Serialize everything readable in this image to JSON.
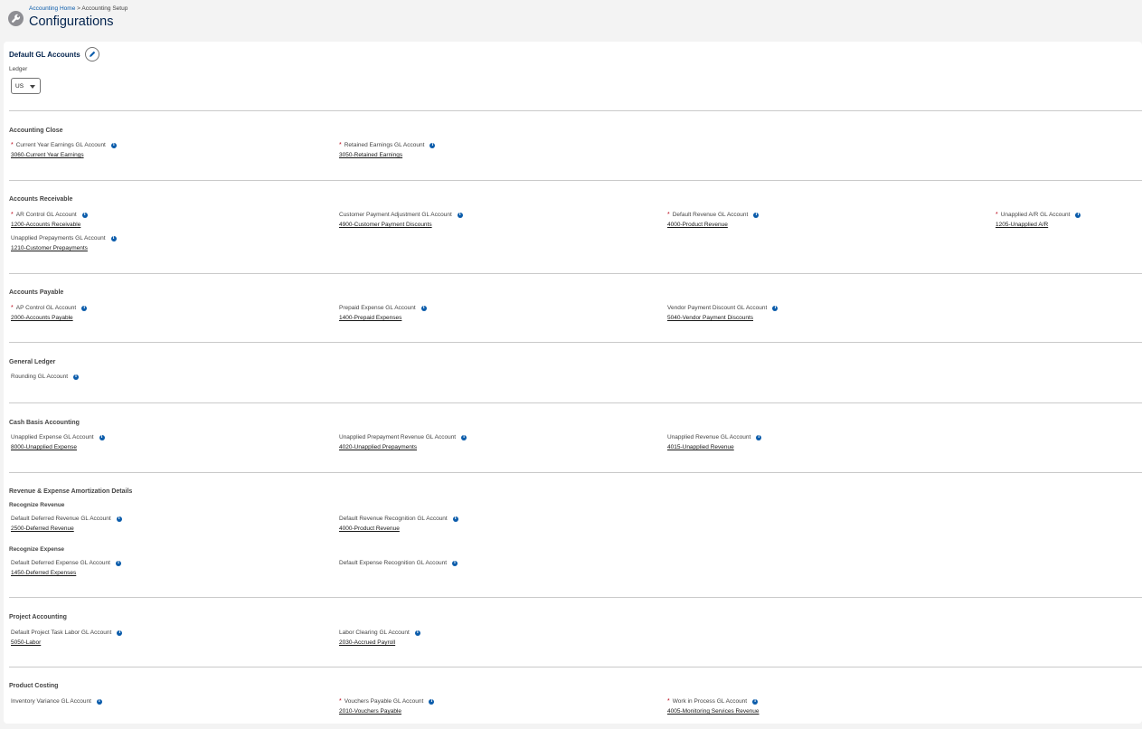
{
  "breadcrumb": {
    "home": "Accounting Home",
    "separator": " > ",
    "current": "Accounting Setup"
  },
  "page_title": "Configurations",
  "card": {
    "title": "Default GL Accounts",
    "ledger_label": "Ledger",
    "ledger_value": "US"
  },
  "sections": {
    "accounting_close": {
      "title": "Accounting Close",
      "f1": {
        "label": "Current Year Earnings GL Account",
        "value": "3060-Current Year Earnings"
      },
      "f2": {
        "label": "Retained Earnings GL Account",
        "value": "3050-Retained Earnings"
      }
    },
    "accounts_receivable": {
      "title": "Accounts Receivable",
      "f1": {
        "label": "AR Control GL Account",
        "value": "1200-Accounts Receivable"
      },
      "f2": {
        "label": "Customer Payment Adjustment GL Account",
        "value": "4900-Customer Payment Discounts"
      },
      "f3": {
        "label": "Default Revenue GL Account",
        "value": "4000-Product Revenue"
      },
      "f4": {
        "label": "Unapplied A/R GL Account",
        "value": "1205-Unapplied A/R"
      },
      "f5": {
        "label": "Unapplied Prepayments GL Account",
        "value": "1210-Customer Prepayments"
      }
    },
    "accounts_payable": {
      "title": "Accounts Payable",
      "f1": {
        "label": "AP Control GL Account",
        "value": "2000-Accounts Payable"
      },
      "f2": {
        "label": "Prepaid Expense GL Account",
        "value": "1400-Prepaid Expenses"
      },
      "f3": {
        "label": "Vendor Payment Discount GL Account",
        "value": "5040-Vendor Payment Discounts"
      }
    },
    "general_ledger": {
      "title": "General Ledger",
      "f1": {
        "label": "Rounding GL Account"
      }
    },
    "cash_basis": {
      "title": "Cash Basis Accounting",
      "f1": {
        "label": "Unapplied Expense GL Account",
        "value": "8000-Unapplied Expense"
      },
      "f2": {
        "label": "Unapplied Prepayment Revenue GL Account",
        "value": "4020-Unapplied Prepayments"
      },
      "f3": {
        "label": "Unapplied Revenue GL Account",
        "value": "4015-Unapplied Revenue"
      }
    },
    "amortization": {
      "title": "Revenue & Expense Amortization Details",
      "recognize_revenue": "Recognize Revenue",
      "f1": {
        "label": "Default Deferred Revenue GL Account",
        "value": "2500-Deferred Revenue"
      },
      "f2": {
        "label": "Default Revenue Recognition GL Account",
        "value": "4000-Product Revenue"
      },
      "recognize_expense": "Recognize Expense",
      "f3": {
        "label": "Default Deferred Expense GL Account",
        "value": "1450-Deferred Expenses"
      },
      "f4": {
        "label": "Default Expense Recognition GL Account"
      }
    },
    "project_accounting": {
      "title": "Project Accounting",
      "f1": {
        "label": "Default Project Task Labor GL Account",
        "value": "5050-Labor"
      },
      "f2": {
        "label": "Labor Clearing GL Account",
        "value": "2030-Accrued Payroll"
      }
    },
    "product_costing": {
      "title": "Product Costing",
      "f1": {
        "label": "Inventory Variance GL Account"
      },
      "f2": {
        "label": "Vouchers Payable GL Account",
        "value": "2010-Vouchers Payable"
      },
      "f3": {
        "label": "Work in Process GL Account",
        "value": "4005-Monitoring Services Revenue"
      }
    }
  },
  "required_marker": "*",
  "info_glyph": "i",
  "icons": {
    "header": "wrench-icon",
    "edit": "pencil-icon",
    "info": "info-icon",
    "dropdown": "caret-down-icon"
  },
  "colors": {
    "title": "#03234d",
    "link": "#0b5cab",
    "required": "#ba0517",
    "info": "#0b5cab"
  }
}
